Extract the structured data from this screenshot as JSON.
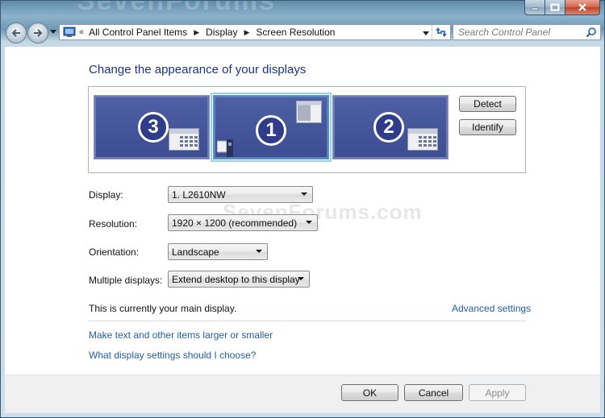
{
  "titlebar": {
    "watermark": "SevenForums"
  },
  "caption": {
    "minimize_icon": "minimize-icon",
    "maximize_icon": "maximize-icon",
    "close_icon": "close-icon"
  },
  "nav": {
    "breadcrumbs": [
      "All Control Panel Items",
      "Display",
      "Screen Resolution"
    ],
    "search_placeholder": "Search Control Panel"
  },
  "page": {
    "title": "Change the appearance of your displays",
    "watermark": "SevenForums.com"
  },
  "monitors": [
    {
      "number": "3",
      "selected": false
    },
    {
      "number": "1",
      "selected": true
    },
    {
      "number": "2",
      "selected": false
    }
  ],
  "buttons": {
    "detect": "Detect",
    "identify": "Identify",
    "ok": "OK",
    "cancel": "Cancel",
    "apply": "Apply"
  },
  "settings": {
    "display_label": "Display:",
    "display_value": "1. L2610NW",
    "resolution_label": "Resolution:",
    "resolution_value": "1920 × 1200 (recommended)",
    "orientation_label": "Orientation:",
    "orientation_value": "Landscape",
    "multiple_label": "Multiple displays:",
    "multiple_value": "Extend desktop to this display"
  },
  "status": {
    "main_display_text": "This is currently your main display."
  },
  "links": {
    "advanced": "Advanced settings",
    "text_size": "Make text and other items larger or smaller",
    "help": "What display settings should I choose?"
  },
  "colors": {
    "title": "#1e3287",
    "link": "#1f5ea8",
    "monitor": "#3d4d92",
    "selected_outline": "#8fd3f5"
  }
}
